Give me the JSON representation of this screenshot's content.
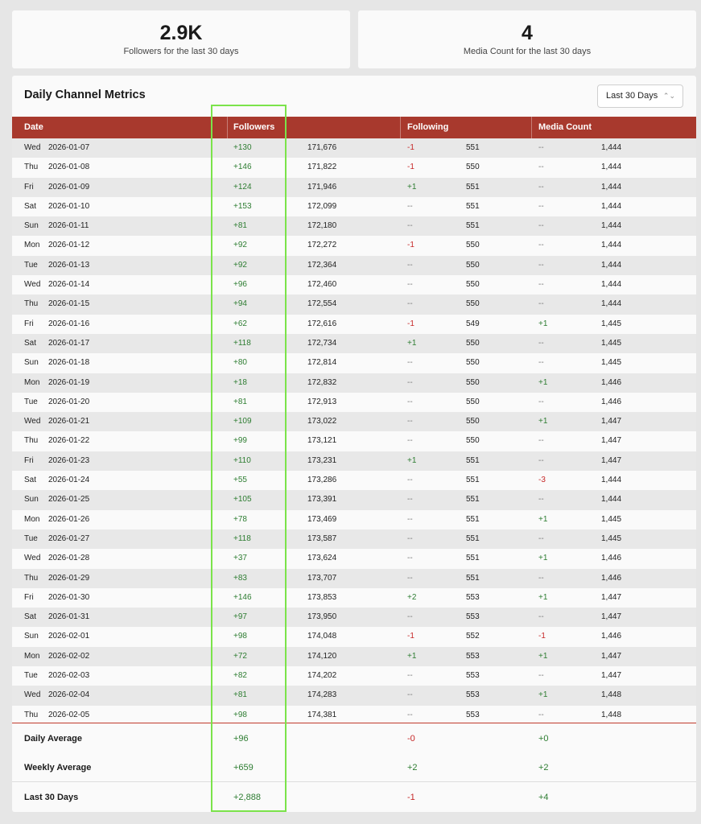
{
  "stats": [
    {
      "value": "2.9K",
      "label": "Followers for the last 30 days"
    },
    {
      "value": "4",
      "label": "Media Count for the last 30 days"
    }
  ],
  "panel": {
    "title": "Daily Channel Metrics",
    "range_select": "Last 30 Days"
  },
  "columns": {
    "date": "Date",
    "followers": "Followers",
    "following": "Following",
    "media": "Media Count"
  },
  "rows": [
    {
      "day": "Wed",
      "date": "2026-01-07",
      "fd": "+130",
      "ft": "171,676",
      "gd": "-1",
      "gt": "551",
      "md": "--",
      "mt": "1,444"
    },
    {
      "day": "Thu",
      "date": "2026-01-08",
      "fd": "+146",
      "ft": "171,822",
      "gd": "-1",
      "gt": "550",
      "md": "--",
      "mt": "1,444"
    },
    {
      "day": "Fri",
      "date": "2026-01-09",
      "fd": "+124",
      "ft": "171,946",
      "gd": "+1",
      "gt": "551",
      "md": "--",
      "mt": "1,444"
    },
    {
      "day": "Sat",
      "date": "2026-01-10",
      "fd": "+153",
      "ft": "172,099",
      "gd": "--",
      "gt": "551",
      "md": "--",
      "mt": "1,444"
    },
    {
      "day": "Sun",
      "date": "2026-01-11",
      "fd": "+81",
      "ft": "172,180",
      "gd": "--",
      "gt": "551",
      "md": "--",
      "mt": "1,444"
    },
    {
      "day": "Mon",
      "date": "2026-01-12",
      "fd": "+92",
      "ft": "172,272",
      "gd": "-1",
      "gt": "550",
      "md": "--",
      "mt": "1,444"
    },
    {
      "day": "Tue",
      "date": "2026-01-13",
      "fd": "+92",
      "ft": "172,364",
      "gd": "--",
      "gt": "550",
      "md": "--",
      "mt": "1,444"
    },
    {
      "day": "Wed",
      "date": "2026-01-14",
      "fd": "+96",
      "ft": "172,460",
      "gd": "--",
      "gt": "550",
      "md": "--",
      "mt": "1,444"
    },
    {
      "day": "Thu",
      "date": "2026-01-15",
      "fd": "+94",
      "ft": "172,554",
      "gd": "--",
      "gt": "550",
      "md": "--",
      "mt": "1,444"
    },
    {
      "day": "Fri",
      "date": "2026-01-16",
      "fd": "+62",
      "ft": "172,616",
      "gd": "-1",
      "gt": "549",
      "md": "+1",
      "mt": "1,445"
    },
    {
      "day": "Sat",
      "date": "2026-01-17",
      "fd": "+118",
      "ft": "172,734",
      "gd": "+1",
      "gt": "550",
      "md": "--",
      "mt": "1,445"
    },
    {
      "day": "Sun",
      "date": "2026-01-18",
      "fd": "+80",
      "ft": "172,814",
      "gd": "--",
      "gt": "550",
      "md": "--",
      "mt": "1,445"
    },
    {
      "day": "Mon",
      "date": "2026-01-19",
      "fd": "+18",
      "ft": "172,832",
      "gd": "--",
      "gt": "550",
      "md": "+1",
      "mt": "1,446"
    },
    {
      "day": "Tue",
      "date": "2026-01-20",
      "fd": "+81",
      "ft": "172,913",
      "gd": "--",
      "gt": "550",
      "md": "--",
      "mt": "1,446"
    },
    {
      "day": "Wed",
      "date": "2026-01-21",
      "fd": "+109",
      "ft": "173,022",
      "gd": "--",
      "gt": "550",
      "md": "+1",
      "mt": "1,447"
    },
    {
      "day": "Thu",
      "date": "2026-01-22",
      "fd": "+99",
      "ft": "173,121",
      "gd": "--",
      "gt": "550",
      "md": "--",
      "mt": "1,447"
    },
    {
      "day": "Fri",
      "date": "2026-01-23",
      "fd": "+110",
      "ft": "173,231",
      "gd": "+1",
      "gt": "551",
      "md": "--",
      "mt": "1,447"
    },
    {
      "day": "Sat",
      "date": "2026-01-24",
      "fd": "+55",
      "ft": "173,286",
      "gd": "--",
      "gt": "551",
      "md": "-3",
      "mt": "1,444"
    },
    {
      "day": "Sun",
      "date": "2026-01-25",
      "fd": "+105",
      "ft": "173,391",
      "gd": "--",
      "gt": "551",
      "md": "--",
      "mt": "1,444"
    },
    {
      "day": "Mon",
      "date": "2026-01-26",
      "fd": "+78",
      "ft": "173,469",
      "gd": "--",
      "gt": "551",
      "md": "+1",
      "mt": "1,445"
    },
    {
      "day": "Tue",
      "date": "2026-01-27",
      "fd": "+118",
      "ft": "173,587",
      "gd": "--",
      "gt": "551",
      "md": "--",
      "mt": "1,445"
    },
    {
      "day": "Wed",
      "date": "2026-01-28",
      "fd": "+37",
      "ft": "173,624",
      "gd": "--",
      "gt": "551",
      "md": "+1",
      "mt": "1,446"
    },
    {
      "day": "Thu",
      "date": "2026-01-29",
      "fd": "+83",
      "ft": "173,707",
      "gd": "--",
      "gt": "551",
      "md": "--",
      "mt": "1,446"
    },
    {
      "day": "Fri",
      "date": "2026-01-30",
      "fd": "+146",
      "ft": "173,853",
      "gd": "+2",
      "gt": "553",
      "md": "+1",
      "mt": "1,447"
    },
    {
      "day": "Sat",
      "date": "2026-01-31",
      "fd": "+97",
      "ft": "173,950",
      "gd": "--",
      "gt": "553",
      "md": "--",
      "mt": "1,447"
    },
    {
      "day": "Sun",
      "date": "2026-02-01",
      "fd": "+98",
      "ft": "174,048",
      "gd": "-1",
      "gt": "552",
      "md": "-1",
      "mt": "1,446"
    },
    {
      "day": "Mon",
      "date": "2026-02-02",
      "fd": "+72",
      "ft": "174,120",
      "gd": "+1",
      "gt": "553",
      "md": "+1",
      "mt": "1,447"
    },
    {
      "day": "Tue",
      "date": "2026-02-03",
      "fd": "+82",
      "ft": "174,202",
      "gd": "--",
      "gt": "553",
      "md": "--",
      "mt": "1,447"
    },
    {
      "day": "Wed",
      "date": "2026-02-04",
      "fd": "+81",
      "ft": "174,283",
      "gd": "--",
      "gt": "553",
      "md": "+1",
      "mt": "1,448"
    },
    {
      "day": "Thu",
      "date": "2026-02-05",
      "fd": "+98",
      "ft": "174,381",
      "gd": "--",
      "gt": "553",
      "md": "--",
      "mt": "1,448"
    }
  ],
  "summary": [
    {
      "label": "Daily Average",
      "fd": "+96",
      "gd": "-0",
      "md": "+0"
    },
    {
      "label": "Weekly Average",
      "fd": "+659",
      "gd": "+2",
      "md": "+2"
    },
    {
      "label": "Last 30 Days",
      "fd": "+2,888",
      "gd": "-1",
      "md": "+4"
    }
  ],
  "colors": {
    "header_bg": "#a8392d",
    "positive": "#2e7d32",
    "negative": "#c62828",
    "highlight": "#7be34a"
  }
}
